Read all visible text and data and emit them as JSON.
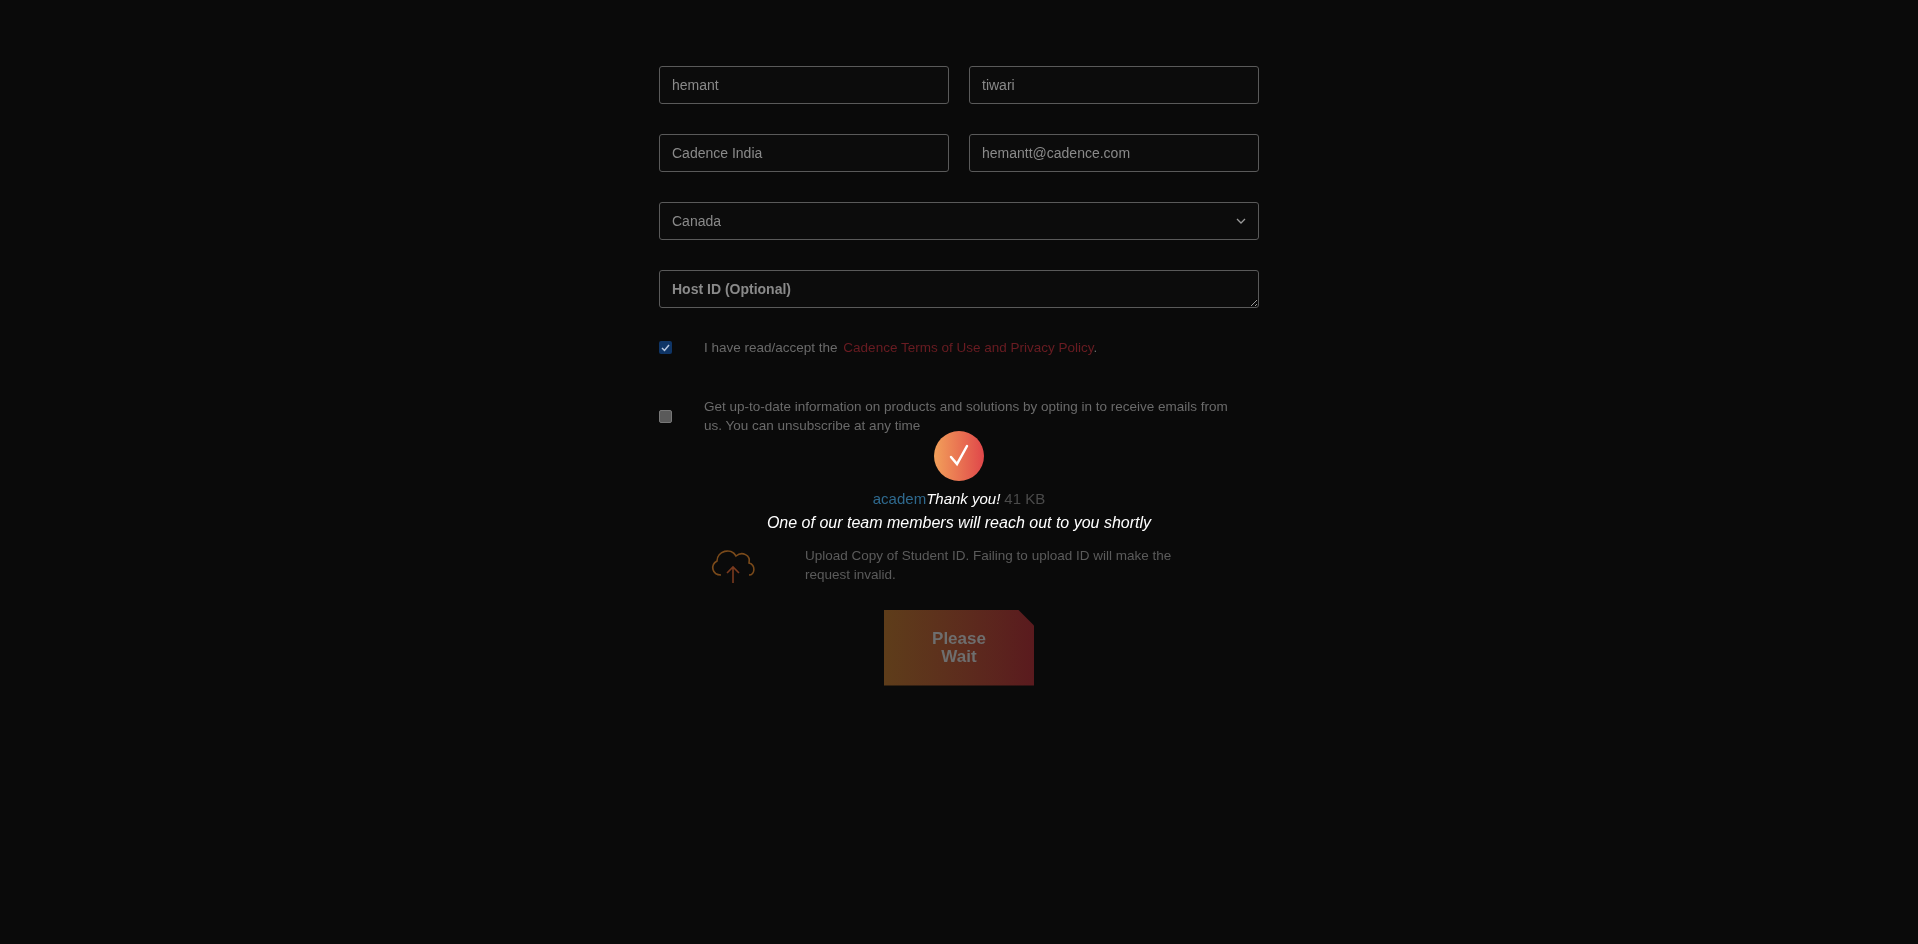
{
  "fields": [
    {
      "kind": "input",
      "value": "hemant"
    },
    {
      "kind": "input",
      "value": "tiwari"
    },
    {
      "kind": "input",
      "value": "Cadence India"
    },
    {
      "kind": "input",
      "value": "hemantt@cadence.com"
    },
    {
      "kind": "select",
      "value": "Canada"
    },
    {
      "kind": "textarea",
      "placeholder": "Host ID (Optional)"
    }
  ],
  "consents": [
    {
      "checked": true,
      "text": "I have read/accept the",
      "link": "Cadence Terms of Use and Privacy Policy",
      "suffix": "."
    },
    {
      "checked": false,
      "text": "Get up-to-date information on products and solutions by opting in to receive emails from us. You can unsubscribe at any time"
    }
  ],
  "confirmation": {
    "title": "Thank you!",
    "message": "One of our team members will reach out to you shortly"
  },
  "file": {
    "name": "academ",
    "size": "41 KB"
  },
  "upload": {
    "text": "Upload Copy of Student ID. Failing to upload ID will make the request invalid."
  },
  "submit_button": {
    "label": "Please Wait"
  }
}
